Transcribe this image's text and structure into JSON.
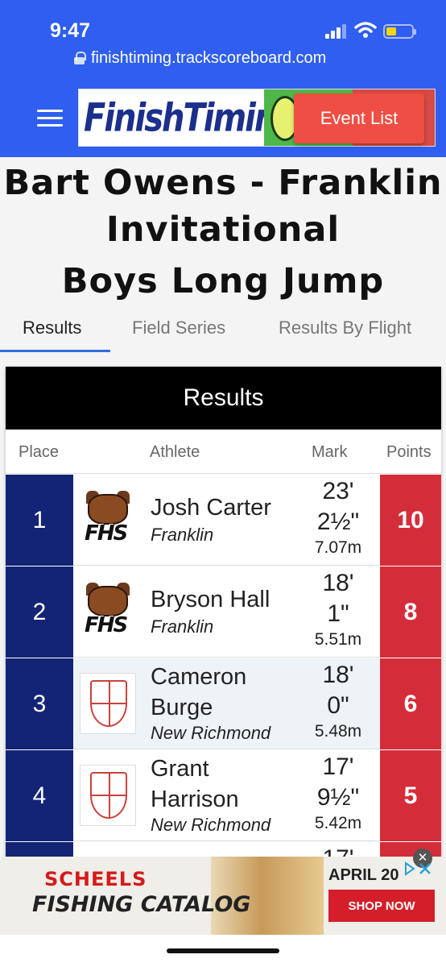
{
  "status_bar": {
    "time": "9:47"
  },
  "browser": {
    "url": "finishtiming.trackscoreboard.com"
  },
  "header": {
    "logo_text": "FinishTiming",
    "event_list_label": "Event List"
  },
  "page": {
    "title_line1": "Bart Owens - Franklin",
    "title_line2": "Invitational",
    "event_name": "Boys Long Jump"
  },
  "tabs": [
    {
      "label": "Results",
      "active": true
    },
    {
      "label": "Field Series",
      "active": false
    },
    {
      "label": "Results By Flight",
      "active": false
    }
  ],
  "results": {
    "heading": "Results",
    "columns": {
      "place": "Place",
      "athlete": "Athlete",
      "mark": "Mark",
      "points": "Points"
    },
    "rows": [
      {
        "place": "1",
        "name": "Josh Carter",
        "school": "Franklin",
        "mark_ft": "23'",
        "mark_in": "2½\"",
        "mark_m": "7.07m",
        "points": "10",
        "logo": "franklin-logo"
      },
      {
        "place": "2",
        "name": "Bryson Hall",
        "school": "Franklin",
        "mark_ft": "18'",
        "mark_in": "1\"",
        "mark_m": "5.51m",
        "points": "8",
        "logo": "franklin-logo"
      },
      {
        "place": "3",
        "name_line1": "Cameron",
        "name_line2": "Burge",
        "school": "New Richmond",
        "mark_ft": "18'",
        "mark_in": "0\"",
        "mark_m": "5.48m",
        "points": "6",
        "logo": "new-richmond-logo"
      },
      {
        "place": "4",
        "name_line1": "Grant",
        "name_line2": "Harrison",
        "school": "New Richmond",
        "mark_ft": "17'",
        "mark_in": "9½\"",
        "mark_m": "5.42m",
        "points": "5",
        "logo": "new-richmond-logo"
      },
      {
        "mark_ft": "17'"
      }
    ]
  },
  "ad": {
    "brand": "SCHEELS",
    "headline": "FISHING CATALOG",
    "date": "APRIL 20",
    "cta": "SHOP NOW",
    "close": "✕"
  },
  "colors": {
    "topbar": "#2f5ef0",
    "place_bg": "#132477",
    "points_bg": "#d42d3a",
    "event_list": "#ee4e44"
  }
}
